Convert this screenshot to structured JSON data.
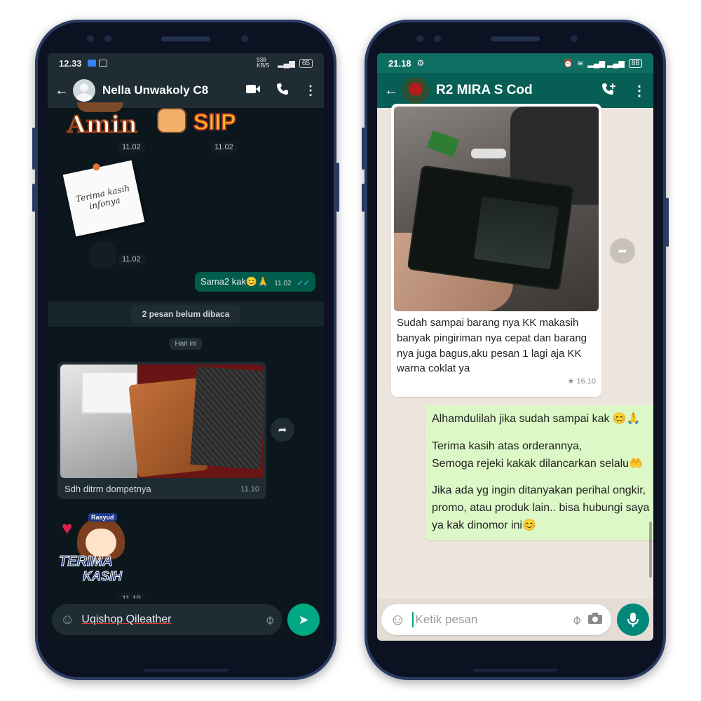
{
  "left_phone": {
    "status_bar": {
      "time": "12.33",
      "speed": "938 KB/S",
      "battery": "65"
    },
    "header": {
      "contact_name": "Nella Unwakoly C8"
    },
    "stickers": {
      "amin_text": "Amin",
      "siip_text": "SIIP",
      "terima_kasih_note": "Terima kasih infonya",
      "terima_kasih_sticker_line1": "TERIMA",
      "terima_kasih_sticker_line2": "KASIH",
      "sticker_badge": "Rasyud"
    },
    "timestamps": {
      "amin": "11.02",
      "siip": "11.02",
      "note": "11.02",
      "sticker_end": "11.10"
    },
    "outgoing_message": {
      "text": "Sama2 kak😊🙏",
      "time": "11.02"
    },
    "unread_banner": "2 pesan belum dibaca",
    "day_label": "Hari ini",
    "image_message": {
      "caption": "Sdh ditrm dompetnya",
      "time": "11.10"
    },
    "composer": {
      "value": "Uqishop Qileather"
    }
  },
  "right_phone": {
    "status_bar": {
      "time": "21.18",
      "battery": "88"
    },
    "header": {
      "contact_name": "R2 MIRA S Cod"
    },
    "incoming_message": {
      "caption": "Sudah sampai barang nya KK makasih banyak pingiriman nya cepat dan barang nya juga bagus,aku pesan 1 lagi aja KK warna coklat ya",
      "time": "16.10"
    },
    "reply_message": {
      "line1": "Alhamdulilah jika sudah sampai kak 😊🙏",
      "line2": "Terima kasih atas orderannya,",
      "line3": "Semoga rejeki kakak dilancarkan selalu🤲",
      "line4": "Jika ada yg ingin ditanyakan perihal ongkir, promo, atau produk lain.. bisa hubungi saya ya kak dinomor ini😊"
    },
    "composer": {
      "placeholder": "Ketik pesan"
    }
  },
  "colors": {
    "dark_header": "#1f2c33",
    "dark_bg": "#0b171c",
    "outgoing_dark": "#005c4b",
    "light_header": "#075e54",
    "light_bg": "#ece5dd",
    "outgoing_light": "#dcf8c6",
    "accent": "#00a884"
  }
}
